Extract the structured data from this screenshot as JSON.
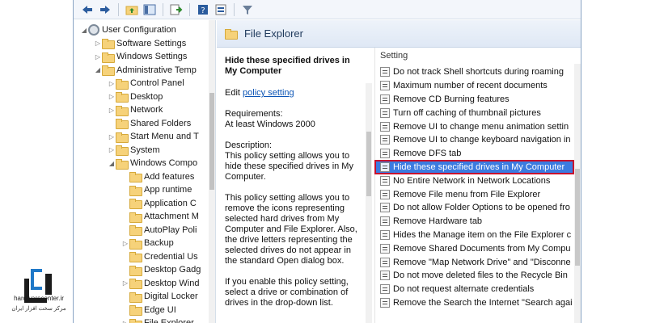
{
  "toolbar": {
    "icons": [
      "back-arrow-icon",
      "forward-arrow-icon",
      "up-folder-icon",
      "show-hide-tree-icon",
      "export-list-icon",
      "help-icon",
      "properties-icon",
      "filter-icon"
    ]
  },
  "tree": {
    "items": [
      {
        "label": "User Configuration",
        "indent": 0,
        "arrow": "◢",
        "icon": "gear"
      },
      {
        "label": "Software Settings",
        "indent": 1,
        "arrow": "▷",
        "icon": "folder"
      },
      {
        "label": "Windows Settings",
        "indent": 1,
        "arrow": "▷",
        "icon": "folder"
      },
      {
        "label": "Administrative Temp",
        "indent": 1,
        "arrow": "◢",
        "icon": "folder"
      },
      {
        "label": "Control Panel",
        "indent": 2,
        "arrow": "▷",
        "icon": "folder"
      },
      {
        "label": "Desktop",
        "indent": 2,
        "arrow": "▷",
        "icon": "folder"
      },
      {
        "label": "Network",
        "indent": 2,
        "arrow": "▷",
        "icon": "folder"
      },
      {
        "label": "Shared Folders",
        "indent": 2,
        "arrow": "",
        "icon": "folder"
      },
      {
        "label": "Start Menu and T",
        "indent": 2,
        "arrow": "▷",
        "icon": "folder"
      },
      {
        "label": "System",
        "indent": 2,
        "arrow": "▷",
        "icon": "folder"
      },
      {
        "label": "Windows Compo",
        "indent": 2,
        "arrow": "◢",
        "icon": "folder"
      },
      {
        "label": "Add features",
        "indent": 3,
        "arrow": "",
        "icon": "folder"
      },
      {
        "label": "App runtime",
        "indent": 3,
        "arrow": "",
        "icon": "folder"
      },
      {
        "label": "Application C",
        "indent": 3,
        "arrow": "",
        "icon": "folder"
      },
      {
        "label": "Attachment M",
        "indent": 3,
        "arrow": "",
        "icon": "folder"
      },
      {
        "label": "AutoPlay Poli",
        "indent": 3,
        "arrow": "",
        "icon": "folder"
      },
      {
        "label": "Backup",
        "indent": 3,
        "arrow": "▷",
        "icon": "folder"
      },
      {
        "label": "Credential Us",
        "indent": 3,
        "arrow": "",
        "icon": "folder"
      },
      {
        "label": "Desktop Gadg",
        "indent": 3,
        "arrow": "",
        "icon": "folder"
      },
      {
        "label": "Desktop Wind",
        "indent": 3,
        "arrow": "▷",
        "icon": "folder"
      },
      {
        "label": "Digital Locker",
        "indent": 3,
        "arrow": "",
        "icon": "folder"
      },
      {
        "label": "Edge UI",
        "indent": 3,
        "arrow": "",
        "icon": "folder"
      },
      {
        "label": "File Explorer",
        "indent": 3,
        "arrow": "▷",
        "icon": "folder"
      }
    ]
  },
  "header": {
    "title": "File Explorer"
  },
  "description": {
    "title": "Hide these specified drives in My Computer",
    "edit_prefix": "Edit",
    "edit_link": "policy setting",
    "requirements_label": "Requirements:",
    "requirements_value": "At least Windows 2000",
    "description_label": "Description:",
    "para1": "This policy setting allows you to hide these specified drives in My Computer.",
    "para2": "This policy setting allows you to remove the icons representing selected hard drives from My Computer and File Explorer. Also, the drive letters representing the selected drives do not appear in the standard Open dialog box.",
    "para3": "If you enable this policy setting, select a drive or combination of drives in the drop-down list."
  },
  "list": {
    "column_header": "Setting",
    "rows": [
      "Do not track Shell shortcuts during roaming",
      "Maximum number of recent documents",
      "Remove CD Burning features",
      "Turn off caching of thumbnail pictures",
      "Remove UI to change menu animation settin",
      "Remove UI to change keyboard navigation in",
      "Remove DFS tab",
      "Hide these specified drives in My Computer",
      "No Entire Network in Network Locations",
      "Remove File menu from File Explorer",
      "Do not allow Folder Options to be opened fro",
      "Remove Hardware tab",
      "Hides the Manage item on the File Explorer c",
      "Remove Shared Documents from My Compu",
      "Remove \"Map Network Drive\" and \"Disconne",
      "Do not move deleted files to the Recycle Bin",
      "Do not request alternate credentials",
      "Remove the Search the Internet \"Search agai"
    ],
    "selected_index": 7
  },
  "logo": {
    "brand": "hardwarecenter.ir",
    "tagline": "مرکز سخت افزار ایران",
    "accent_color": "#1f78c8"
  }
}
